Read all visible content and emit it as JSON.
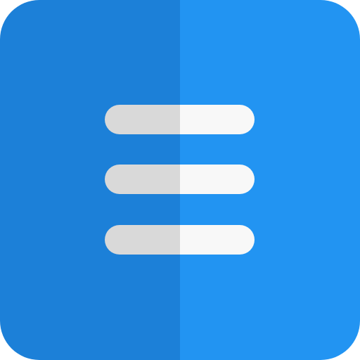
{
  "icon": {
    "name": "hamburger-menu-icon",
    "line_count": 3
  },
  "colors": {
    "tile_left": "#1C80D8",
    "tile_right": "#2294F2",
    "bar_left": "#D9D9D9",
    "bar_right": "#F8F8F8"
  }
}
